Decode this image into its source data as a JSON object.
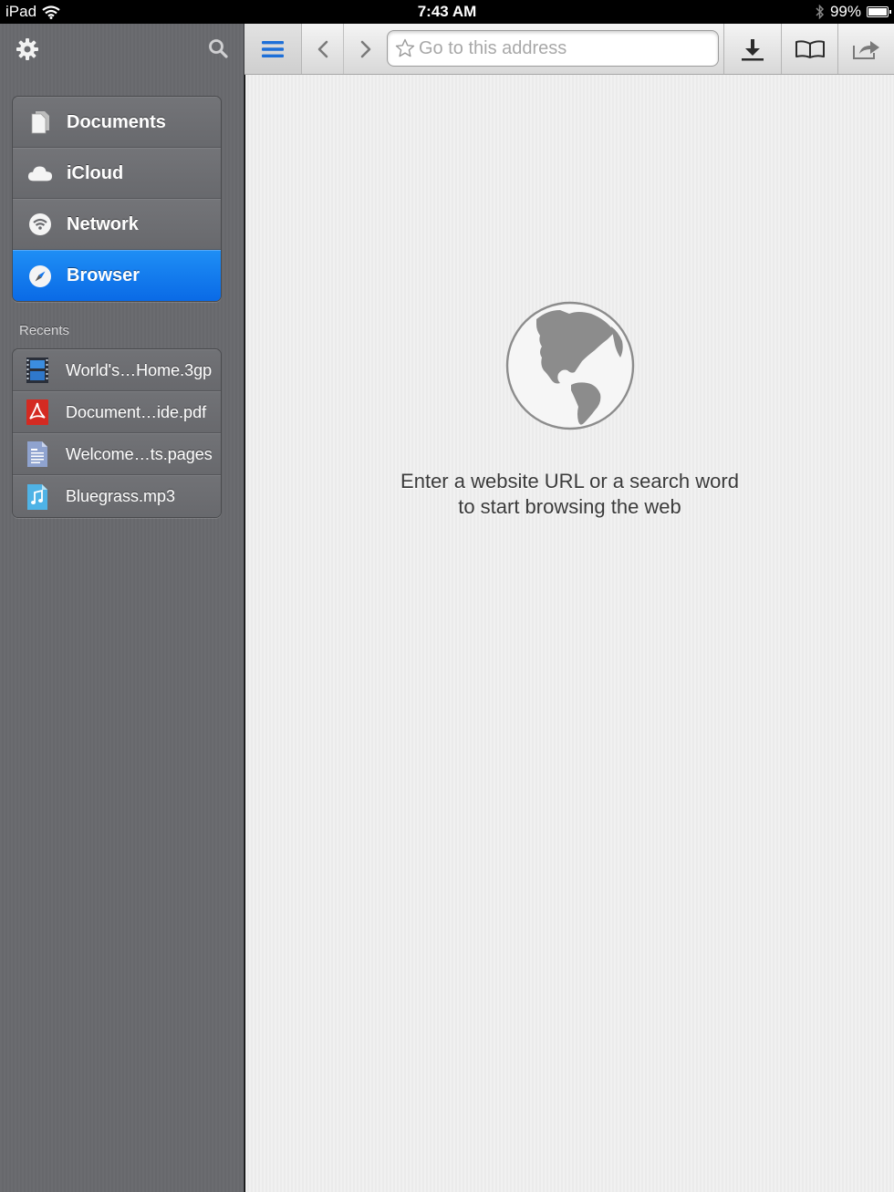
{
  "status_bar": {
    "device": "iPad",
    "time": "7:43 AM",
    "battery": "99%",
    "battery_level": 0.99
  },
  "sidebar": {
    "nav": [
      {
        "label": "Documents",
        "icon": "document-icon"
      },
      {
        "label": "iCloud",
        "icon": "cloud-icon"
      },
      {
        "label": "Network",
        "icon": "wifi-icon"
      },
      {
        "label": "Browser",
        "icon": "compass-icon",
        "active": true
      }
    ],
    "recents_label": "Recents",
    "recents": [
      {
        "label": "World's…Home.3gp",
        "icon": "video-file-icon"
      },
      {
        "label": "Document…ide.pdf",
        "icon": "pdf-file-icon"
      },
      {
        "label": "Welcome…ts.pages",
        "icon": "pages-file-icon"
      },
      {
        "label": "Bluegrass.mp3",
        "icon": "audio-file-icon"
      }
    ]
  },
  "toolbar": {
    "address_placeholder": "Go to this address",
    "address_value": ""
  },
  "content": {
    "message_line1": "Enter a website URL or a search word",
    "message_line2": "to start browsing the web"
  },
  "colors": {
    "accent": "#0a6ae6",
    "sidebar_bg": "#6b6c70",
    "content_bg": "#efefef"
  }
}
